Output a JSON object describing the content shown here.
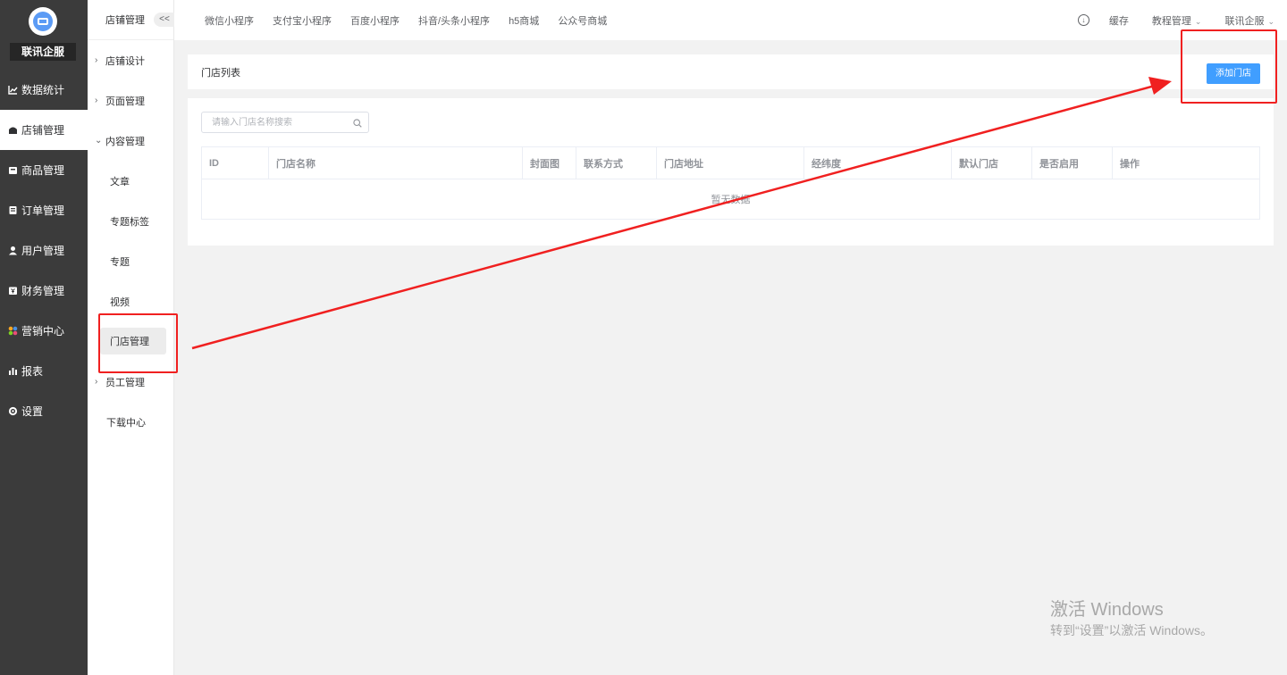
{
  "brand": {
    "name": "联讯企服"
  },
  "sidebar": {
    "items": [
      {
        "label": "数据统计",
        "icon": "line-chart-icon"
      },
      {
        "label": "店铺管理",
        "icon": "store-icon",
        "active": true
      },
      {
        "label": "商品管理",
        "icon": "product-icon"
      },
      {
        "label": "订单管理",
        "icon": "order-icon"
      },
      {
        "label": "用户管理",
        "icon": "user-icon"
      },
      {
        "label": "财务管理",
        "icon": "finance-icon"
      },
      {
        "label": "营销中心",
        "icon": "marketing-icon"
      },
      {
        "label": "报表",
        "icon": "bar-chart-icon"
      },
      {
        "label": "设置",
        "icon": "gear-icon"
      }
    ]
  },
  "subnav": {
    "title": "店铺管理",
    "collapse": "<<",
    "items": [
      {
        "label": "店铺设计"
      },
      {
        "label": "页面管理"
      },
      {
        "label": "内容管理"
      },
      {
        "label": "文章"
      },
      {
        "label": "专题标签"
      },
      {
        "label": "专题"
      },
      {
        "label": "视频"
      },
      {
        "label": "门店管理",
        "active": true
      },
      {
        "label": "员工管理"
      },
      {
        "label": "下载中心"
      }
    ]
  },
  "topbar": {
    "tabs": [
      "微信小程序",
      "支付宝小程序",
      "百度小程序",
      "抖音/头条小程序",
      "h5商城",
      "公众号商城"
    ],
    "cache": "缓存",
    "tutorial": "教程管理",
    "account": "联讯企服"
  },
  "page": {
    "title": "门店列表",
    "add_button": "添加门店",
    "search_placeholder": "请输入门店名称搜索",
    "columns": [
      "ID",
      "门店名称",
      "封面图",
      "联系方式",
      "门店地址",
      "经纬度",
      "默认门店",
      "是否启用",
      "操作"
    ],
    "empty_text": "暂无数据"
  },
  "watermark": {
    "line1": "激活 Windows",
    "line2": "转到“设置”以激活 Windows。"
  },
  "colors": {
    "sidebar_bg": "#3b3b3b",
    "primary": "#409eff",
    "annotation": "#f02020"
  }
}
